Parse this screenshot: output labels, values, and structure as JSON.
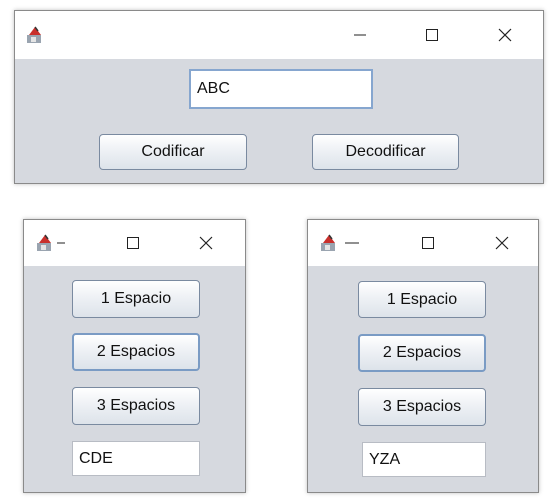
{
  "main_window": {
    "input_value": "ABC",
    "encode_label": "Codificar",
    "decode_label": "Decodificar"
  },
  "left_window": {
    "option_1": "1 Espacio",
    "option_2": "2 Espacios",
    "option_3": "3 Espacios",
    "result": "CDE"
  },
  "right_window": {
    "option_1": "1 Espacio",
    "option_2": "2 Espacios",
    "option_3": "3 Espacios",
    "result": "YZA"
  },
  "icons": {
    "app": "java-app-icon",
    "minimize": "minimize-icon",
    "maximize": "maximize-icon",
    "close": "close-icon"
  }
}
